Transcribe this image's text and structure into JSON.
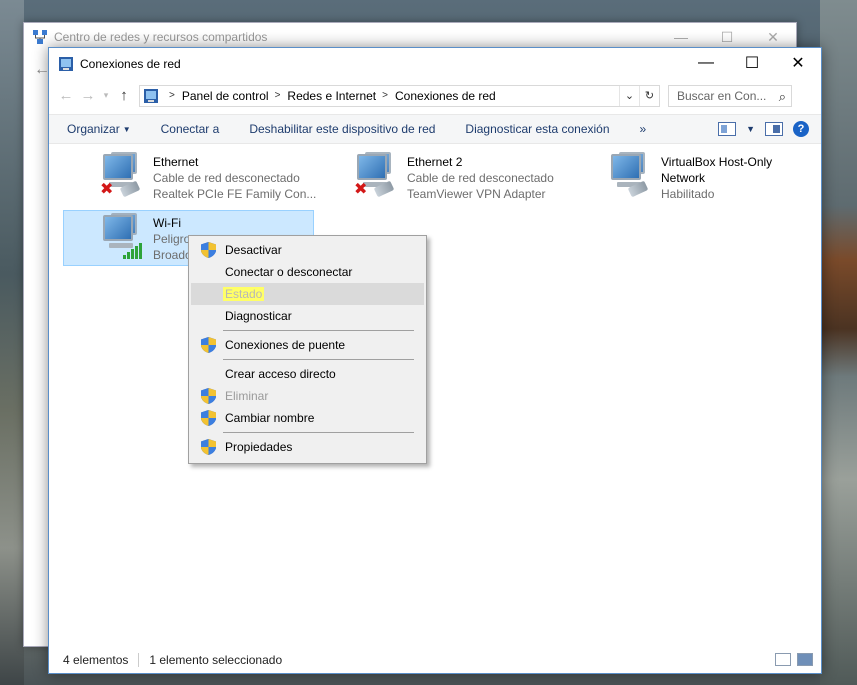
{
  "back_window": {
    "title": "Centro de redes y recursos compartidos"
  },
  "window": {
    "title": "Conexiones de red",
    "minimize": "—",
    "maximize": "☐",
    "close": "✕"
  },
  "address": {
    "crumbs": [
      "Panel de control",
      "Redes e Internet",
      "Conexiones de red"
    ],
    "search_placeholder": "Buscar en Con..."
  },
  "commands": {
    "organize": "Organizar",
    "connect": "Conectar a",
    "disable": "Deshabilitar este dispositivo de red",
    "diagnose": "Diagnosticar esta conexión",
    "more": "»"
  },
  "items": [
    {
      "name": "Ethernet",
      "status": "Cable de red desconectado",
      "device": "Realtek PCIe FE Family Con..."
    },
    {
      "name": "Ethernet 2",
      "status": "Cable de red desconectado",
      "device": "TeamViewer VPN Adapter"
    },
    {
      "name": "VirtualBox Host-Only",
      "name2": "Network",
      "status": "Habilitado"
    },
    {
      "name": "Wi-Fi",
      "status": "Peligro",
      "device": "Broado"
    }
  ],
  "context_menu": {
    "items": [
      {
        "label": "Desactivar",
        "shield": true
      },
      {
        "label": "Conectar o desconectar",
        "shield": false
      },
      {
        "label": "Estado",
        "shield": false,
        "disabled": true
      },
      {
        "label": "Diagnosticar",
        "shield": false
      },
      {
        "label": "Conexiones de puente",
        "shield": true
      },
      {
        "label": "Crear acceso directo",
        "shield": false
      },
      {
        "label": "Eliminar",
        "shield": true,
        "disabled": true
      },
      {
        "label": "Cambiar nombre",
        "shield": true
      },
      {
        "label": "Propiedades",
        "shield": true
      }
    ]
  },
  "status_bar": {
    "count": "4 elementos",
    "selected": "1 elemento seleccionado"
  },
  "colors": {
    "accent": "#1a63c6",
    "selection": "#cce8ff",
    "highlight": "#ffff66"
  }
}
